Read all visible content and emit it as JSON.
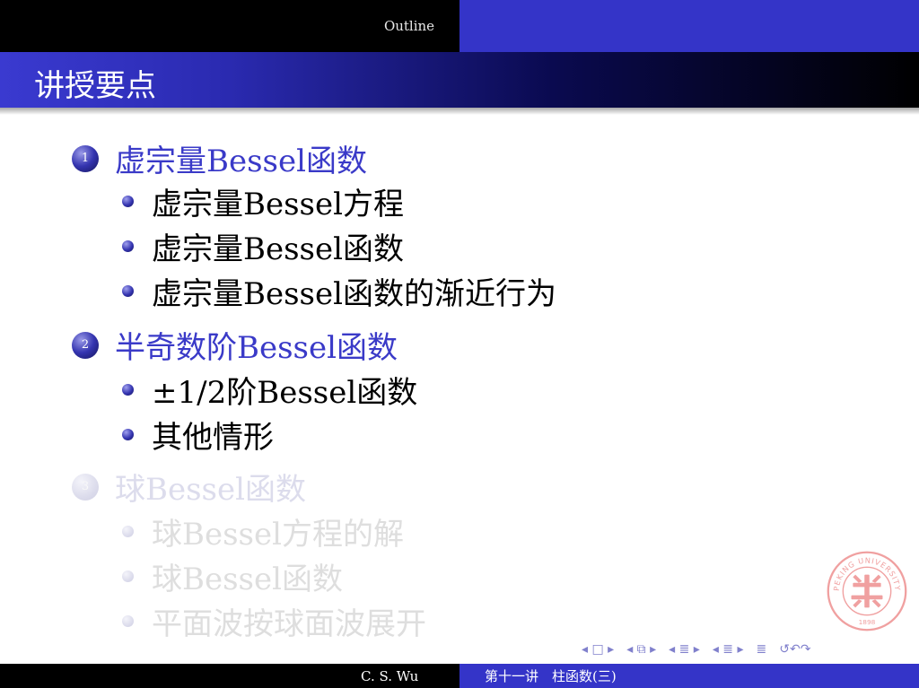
{
  "header": {
    "outline": "Outline"
  },
  "frame_title": "讲授要点",
  "sections": [
    {
      "number": "1",
      "title": "虚宗量Bessel函数",
      "items": [
        "虚宗量Bessel方程",
        "虚宗量Bessel函数",
        "虚宗量Bessel函数的渐近行为"
      ]
    },
    {
      "number": "2",
      "title": "半奇数阶Bessel函数",
      "items": [
        "±1/2阶Bessel函数",
        "其他情形"
      ]
    },
    {
      "number": "3",
      "title": "球Bessel函数",
      "items": [
        "球Bessel方程的解",
        "球Bessel函数",
        "平面波按球面波展开"
      ]
    }
  ],
  "footer": {
    "author": "C. S. Wu",
    "lecture": "第十一讲　柱函数(三)"
  },
  "nav": {
    "frame": "◂ □ ▸",
    "subsection": "◂ ⧉ ▸",
    "section_prev": "◂ ≣ ▸",
    "section_next": "◂ ≣ ▸",
    "align": "≣",
    "search": "↺↶↷"
  },
  "seal": {
    "text": "PEKING UNIVERSITY 1898"
  },
  "colors": {
    "accent": "#3a3ac8",
    "header_right": "#3434c8",
    "faded": "#dcdcec"
  }
}
